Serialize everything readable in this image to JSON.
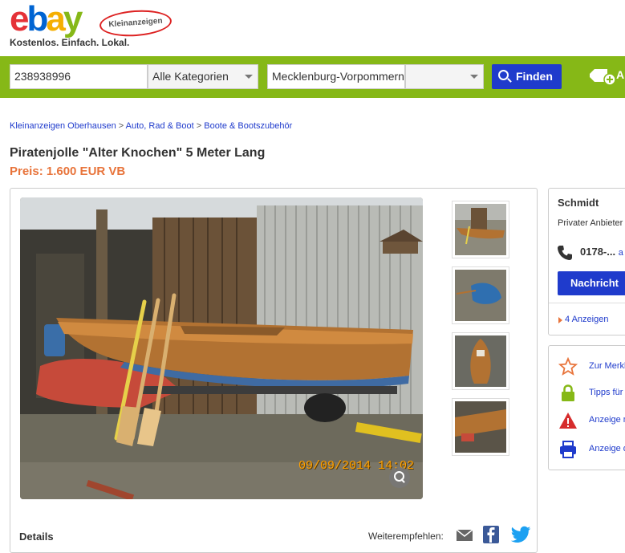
{
  "header": {
    "logo_letters": [
      "e",
      "b",
      "a",
      "y"
    ],
    "logo_badge": "Kleinanzeigen",
    "tagline": "Kostenlos. Einfach. Lokal."
  },
  "search": {
    "query": "238938996",
    "category": "Alle Kategorien",
    "location": "Mecklenburg-Vorpommern",
    "radius": "",
    "find_label": "Finden",
    "post_label": "A"
  },
  "breadcrumb": {
    "items": [
      "Kleinanzeigen Oberhausen",
      "Auto, Rad & Boot",
      "Boote & Bootszubehör"
    ],
    "separator": ">"
  },
  "listing": {
    "title": "Piratenjolle \"Alter Knochen\" 5 Meter Lang",
    "price": "Preis: 1.600 EUR VB",
    "photo_date": "09/09/2014 14:02",
    "details_label": "Details",
    "share_label": "Weiterempfehlen:"
  },
  "seller": {
    "name": "Schmidt",
    "type": "Privater Anbieter",
    "phone": "0178-...",
    "phone_link": "a",
    "message_button": "Nachricht",
    "ads_link": "4 Anzeigen"
  },
  "actions": [
    {
      "label": "Zur Merkliste",
      "icon": "star-icon"
    },
    {
      "label": "Tipps für",
      "icon": "lock-icon"
    },
    {
      "label": "Anzeige melden",
      "icon": "warning-icon"
    },
    {
      "label": "Anzeige drucken",
      "icon": "printer-icon"
    }
  ],
  "colors": {
    "brand_green": "#86b817",
    "button_blue": "#1f3bcc",
    "price_orange": "#e8743b"
  }
}
